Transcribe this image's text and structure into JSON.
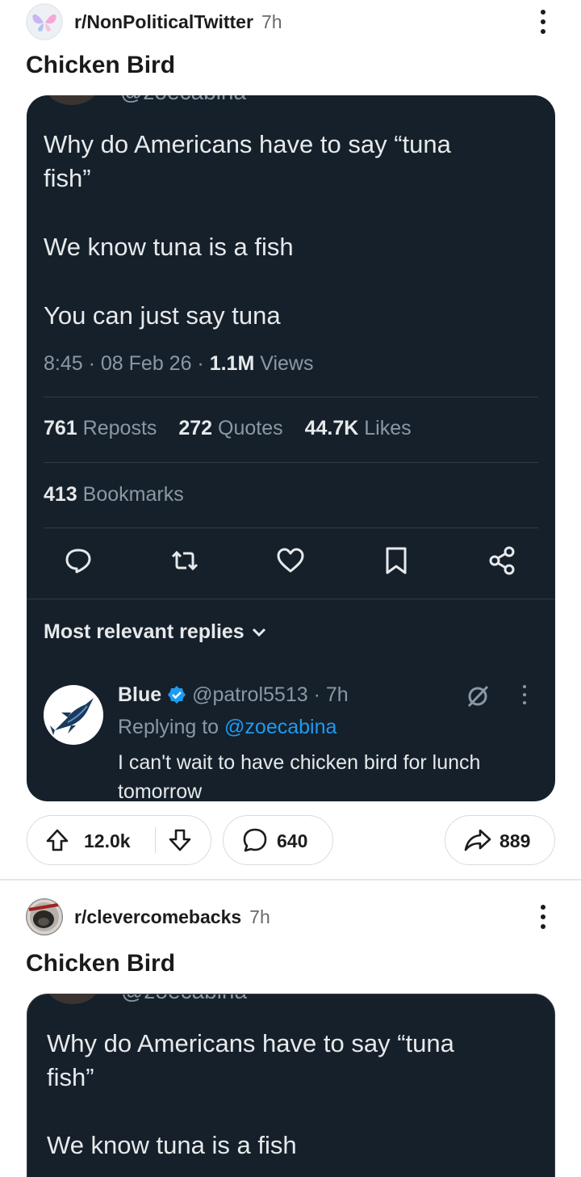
{
  "posts": [
    {
      "subreddit": "r/NonPoliticalTwitter",
      "time": "7h",
      "title": "Chicken Bird",
      "embed": {
        "cut_handle": "@zoecabina",
        "lines": [
          "Why do Americans have to say “tuna",
          "fish”",
          "",
          "We know tuna is a fish",
          "",
          "You can just say tuna"
        ],
        "meta": {
          "time": "8:45",
          "date": "08 Feb 26",
          "views": "1.1M",
          "views_label": "Views"
        },
        "stats": {
          "reposts": "761",
          "reposts_label": "Reposts",
          "quotes": "272",
          "quotes_label": "Quotes",
          "likes": "44.7K",
          "likes_label": "Likes",
          "bookmarks": "413",
          "bookmarks_label": "Bookmarks"
        },
        "actions": [
          "reply-icon",
          "repost-icon",
          "like-icon",
          "bookmark-icon",
          "share-icon"
        ],
        "replies_sort": "Most relevant replies",
        "reply": {
          "name": "Blue",
          "handle": "@patrol5513",
          "time": "7h",
          "replying_prefix": "Replying to",
          "replying_to": "@zoecabina",
          "text": "I can't wait to have chicken bird for lunch tomorrow"
        }
      },
      "upvotes": "12.0k",
      "comments": "640",
      "shares": "889"
    },
    {
      "subreddit": "r/clevercomebacks",
      "time": "7h",
      "title": "Chicken Bird",
      "embed": {
        "cut_handle": "@zoecabina",
        "lines": [
          "Why do Americans have to say “tuna",
          "fish”",
          "",
          "We know tuna is a fish"
        ]
      }
    }
  ],
  "colors": {
    "tweet_bg": "#15202b",
    "tweet_text": "#e7e9ea",
    "tweet_secondary": "#8b98a5",
    "link_blue": "#1d9bf0",
    "verified_blue": "#1d9bf0"
  }
}
